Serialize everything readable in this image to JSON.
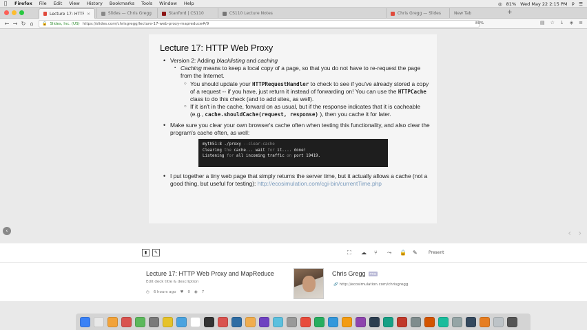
{
  "menubar": {
    "app": "Firefox",
    "items": [
      "File",
      "Edit",
      "View",
      "History",
      "Bookmarks",
      "Tools",
      "Window",
      "Help"
    ],
    "battery": "81%",
    "clock": "Wed May 22 2:15 PM"
  },
  "tabs": [
    {
      "title": "Lecture 17: HTTP Web Proxy",
      "active": true
    },
    {
      "title": "Slides — Chris Gregg",
      "active": false
    },
    {
      "title": "Stanford | CS110",
      "active": false
    },
    {
      "title": "CS110 Lecture Notes",
      "active": false
    },
    {
      "title": "Chris Gregg — Slides",
      "active": false
    },
    {
      "title": "New Tab",
      "active": false
    }
  ],
  "navbar": {
    "site_identity": "Slides, Inc. (US)",
    "url": "https://slides.com/chrisgregg/lecture-17-web-proxy-mapreduce#/9",
    "zoom": "80%"
  },
  "slide": {
    "title": "Lecture 17: HTTP Web Proxy",
    "v2_prefix": "Version 2: Adding ",
    "v2_em1": "blacklisting",
    "v2_and": " and ",
    "v2_em2": "caching",
    "caching_em": "Caching",
    "caching_rest": " means to keep a local copy of a page, so that you do not have to re-request the page from the Internet.",
    "s1_a": "You should update your ",
    "s1_code1": "HTTPRequestHandler",
    "s1_b": " to check to see if you've already stored a copy of a request -- if you have, just return it instead of forwarding on! You can use the ",
    "s1_code2": "HTTPCache",
    "s1_c": " class to do this check (and to add sites, as well).",
    "s2_a": "If it isn't in the cache, forward on as usual, but if the response indicates that it is cacheable (e.g., ",
    "s2_code": "cache.shouldCache(request, response)",
    "s2_b": " ), then you cache it for later.",
    "clear_text": "Make sure you clear your own browser's cache often when testing this functionality, and also clear the program's cache often, as well:",
    "terminal": {
      "line1_prompt": "myth51:8 ./proxy",
      "line1_flag": " --clear-cache",
      "line2_a": "Clearing ",
      "line2_b": "the",
      "line2_c": " cache... wait ",
      "line2_d": "for",
      "line2_e": " it.... done!",
      "line3_a": "Listening ",
      "line3_b": "for",
      "line3_c": " all incoming traffic ",
      "line3_d": "on",
      "line3_e": " port 19419."
    },
    "server_text": "I put together a tiny web page that simply returns the server time, but it actually allows a cache (not a good thing, but useful for testing): ",
    "server_link": "http://ecosimulation.com/cgi-bin/currentTime.php"
  },
  "toolbar": {
    "present_label": "Present"
  },
  "deck": {
    "title": "Lecture 17: HTTP Web Proxy and MapReduce",
    "edit_label": "Edit deck title & description",
    "age": "6 hours ago",
    "likes": "0",
    "views": "7"
  },
  "author": {
    "name": "Chris Gregg",
    "badge": "PRO",
    "url": "http://ecosimulation.com/chrisgregg"
  },
  "dock": {
    "icon_colors": [
      "#3b82f6",
      "#e8e8e8",
      "#f2a33a",
      "#d9534f",
      "#5cb85c",
      "#7a7a7a",
      "#e6c229",
      "#4aa3df",
      "#ffffff",
      "#333333",
      "#d9534f",
      "#2e6da4",
      "#f0ad4e",
      "#6f42c1",
      "#5bc0de",
      "#999999",
      "#e74c3c",
      "#27ae60",
      "#3498db",
      "#f39c12",
      "#8e44ad",
      "#2c3e50",
      "#16a085",
      "#c0392b",
      "#7f8c8d",
      "#d35400",
      "#1abc9c",
      "#95a5a6",
      "#34495e",
      "#e67e22",
      "#bdc3c7",
      "#555555"
    ]
  }
}
